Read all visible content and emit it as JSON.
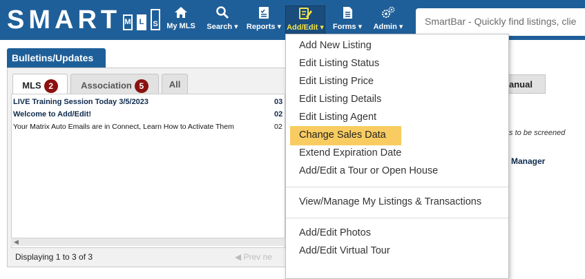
{
  "logo": {
    "text": "SMART",
    "letters": [
      "M",
      "L",
      "S"
    ]
  },
  "nav": {
    "items": [
      {
        "label": "My MLS",
        "icon": "home-icon"
      },
      {
        "label": "Search ▾",
        "icon": "search-icon"
      },
      {
        "label": "Reports ▾",
        "icon": "clipboard-icon"
      },
      {
        "label": "Add/Edit ▾",
        "icon": "edit-icon"
      },
      {
        "label": "Forms ▾",
        "icon": "document-icon"
      },
      {
        "label": "Admin ▾",
        "icon": "gears-icon"
      }
    ]
  },
  "smartbar": {
    "placeholder": "SmartBar - Quickly find listings, clie"
  },
  "bulletins": {
    "title": "Bulletins/Updates",
    "tabs": [
      {
        "label": "MLS",
        "badge": "2"
      },
      {
        "label": "Association",
        "badge": "5"
      },
      {
        "label": "All",
        "badge": ""
      }
    ],
    "rows": [
      {
        "title": "LIVE Training Session Today 3/5/2023",
        "date": "03"
      },
      {
        "title": "Welcome to Add/Edit!",
        "date": "02"
      },
      {
        "title": "Your Matrix Auto Emails are in Connect, Learn How to Activate Them",
        "date": "02"
      }
    ],
    "displaying": "Displaying 1 to 3 of 3",
    "pager": "◀ Prev  ne"
  },
  "right": {
    "manual_tab": "anual",
    "screened_text": "ts to be screened",
    "manager_text": "Manager"
  },
  "dropdown": {
    "group1": [
      "Add New Listing",
      "Edit Listing Status",
      "Edit Listing Price",
      "Edit Listing Details",
      "Edit Listing Agent",
      "Change Sales Data",
      "Extend Expiration Date",
      "Add/Edit a Tour or Open House"
    ],
    "group2": [
      "View/Manage My Listings & Transactions"
    ],
    "group3": [
      "Add/Edit Photos",
      "Add/Edit Virtual Tour"
    ],
    "highlight_index": 5,
    "highlight_color": "#f8cc61"
  },
  "colors": {
    "nav_bg": "#1f5f99",
    "badge": "#8b1111",
    "active_label": "#f5e34a"
  }
}
